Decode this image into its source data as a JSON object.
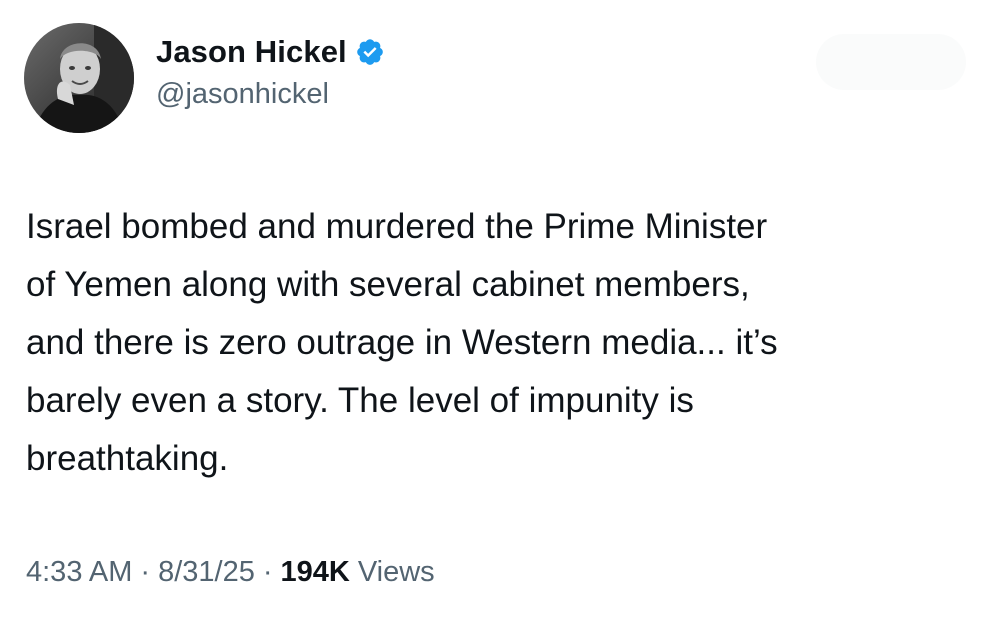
{
  "tweet": {
    "author": {
      "display_name": "Jason Hickel",
      "handle": "@jasonhickel",
      "verified": true,
      "verified_color": "#1d9bf0",
      "avatar_icon": "profile-photo"
    },
    "text": "Israel bombed and murdered the Prime Minister\nof Yemen along with several cabinet members,\nand there is zero outrage in Western media... it’s\nbarely even a story. The level of impunity is\nbreathtaking.",
    "time": "4:33 AM",
    "date": "8/31/25",
    "separator": "·",
    "views_count": "194K",
    "views_label": "Views"
  }
}
